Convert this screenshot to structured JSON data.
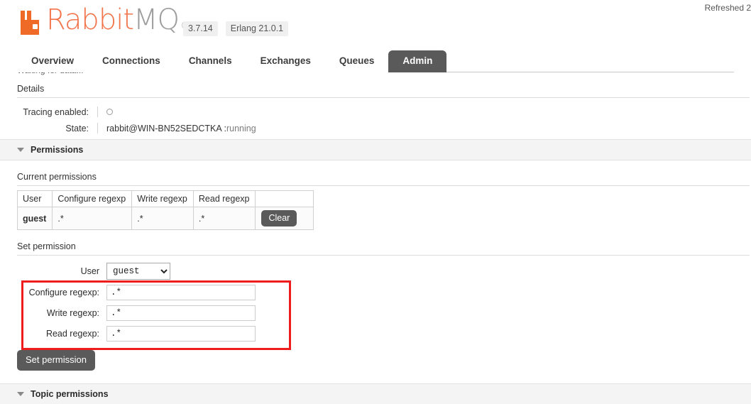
{
  "header": {
    "logo_rabbit": "Rabbit",
    "logo_mq": "MQ",
    "logo_tm": "®",
    "version": "3.7.14",
    "erlang_version": "Erlang 21.0.1",
    "refreshed": "Refreshed 2"
  },
  "waiting_text": "Waiting for data...",
  "tabs": [
    {
      "label": "Overview",
      "selected": false
    },
    {
      "label": "Connections",
      "selected": false
    },
    {
      "label": "Channels",
      "selected": false
    },
    {
      "label": "Exchanges",
      "selected": false
    },
    {
      "label": "Queues",
      "selected": false
    },
    {
      "label": "Admin",
      "selected": true
    }
  ],
  "details": {
    "title": "Details",
    "rows": [
      {
        "key": "Tracing enabled:",
        "value": "",
        "type": "radio"
      },
      {
        "key": "State:",
        "value": "rabbit@WIN-BN52SEDCTKA : ",
        "status": "running",
        "type": "text"
      }
    ]
  },
  "permissions": {
    "section_title": "Permissions",
    "current_label": "Current permissions",
    "table": {
      "headers": [
        "User",
        "Configure regexp",
        "Write regexp",
        "Read regexp",
        ""
      ],
      "rows": [
        {
          "user": "guest",
          "configure": ".*",
          "write": ".*",
          "read": ".*",
          "action": "Clear"
        }
      ]
    },
    "set_label": "Set permission",
    "form": {
      "user_label": "User",
      "user_value": "guest",
      "user_options": [
        "guest"
      ],
      "configure_label": "Configure regexp:",
      "configure_value": ".*",
      "write_label": "Write regexp:",
      "write_value": ".*",
      "read_label": "Read regexp:",
      "read_value": ".*",
      "submit_label": "Set permission"
    }
  },
  "topic_permissions": {
    "section_title": "Topic permissions"
  },
  "colors": {
    "brand_orange": "#f06a27",
    "logo_text_orange": "#f1744b",
    "logo_text_gray": "#9d9d9d",
    "tab_selected_bg": "#5a5a5a",
    "annotation_red": "#ee1c1c",
    "button_gray": "#5a5a5a"
  }
}
